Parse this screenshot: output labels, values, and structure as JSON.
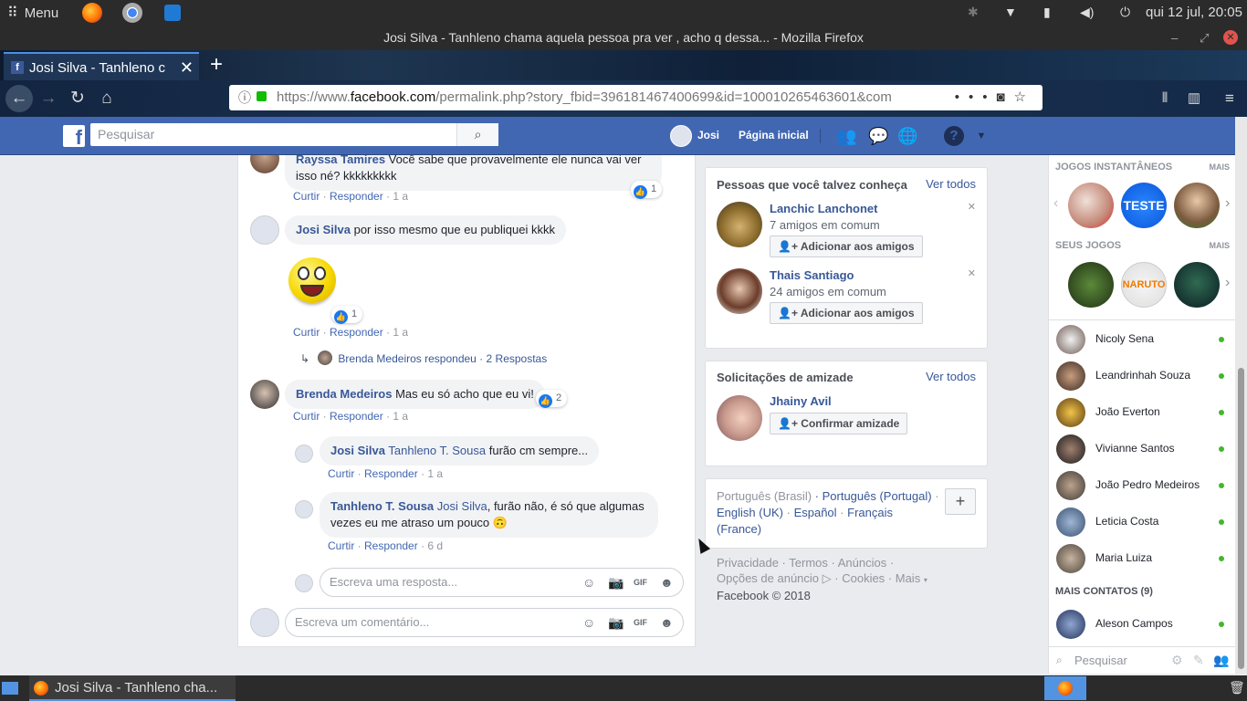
{
  "os": {
    "menu_label": "Menu",
    "clock": "qui 12 jul, 20:05"
  },
  "browser": {
    "window_title": "Josi Silva - Tanhleno chama aquela pessoa pra ver , acho q dessa... - Mozilla Firefox",
    "tab_title": "Josi Silva - Tanhleno c",
    "url_prefix": "https://www.",
    "url_domain": "facebook.com",
    "url_rest": "/permalink.php?story_fbid=396181467400699&id=100010265463601&com"
  },
  "fb": {
    "logo": "f",
    "search_placeholder": "Pesquisar",
    "user_name": "Josi",
    "home_label": "Página inicial"
  },
  "comments": {
    "c1": {
      "name": "Rayssa Tamires",
      "text": " Você sabe que provavelmente ele nunca vai ver isso né? kkkkkkkkk",
      "like": "Curtir",
      "reply": "Responder",
      "time": "1 a",
      "reactions": "1"
    },
    "c2": {
      "name": "Josi Silva",
      "text": " por isso mesmo que eu publiquei kkkk",
      "like": "Curtir",
      "reply": "Responder",
      "time": "1 a",
      "reactions": "1"
    },
    "c2_replies": {
      "name": "Brenda Medeiros respondeu",
      "count": "2 Respostas"
    },
    "c3": {
      "name": "Brenda Medeiros",
      "text": " Mas eu só acho que eu vi!",
      "like": "Curtir",
      "reply": "Responder",
      "time": "1 a",
      "reactions": "2"
    },
    "r1": {
      "name": "Josi Silva",
      "mention": "Tanhleno T. Sousa",
      "text": " furão cm sempre...",
      "like": "Curtir",
      "reply": "Responder",
      "time": "1 a"
    },
    "r2": {
      "name": "Tanhleno T. Sousa",
      "mention": "Josi Silva",
      "text": ", furão não, é só que algumas vezes eu me atraso um pouco 🙃",
      "like": "Curtir",
      "reply": "Responder",
      "time": "6 d"
    },
    "reply_placeholder": "Escreva uma resposta...",
    "comment_placeholder": "Escreva um comentário..."
  },
  "pymk": {
    "title": "Pessoas que você talvez conheça",
    "see_all": "Ver todos",
    "people": [
      {
        "name": "Lanchic Lanchonet",
        "mutual": "7 amigos em comum",
        "button": "Adicionar aos amigos"
      },
      {
        "name": "Thais Santiago",
        "mutual": "24 amigos em comum",
        "button": "Adicionar aos amigos"
      }
    ]
  },
  "requests": {
    "title": "Solicitações de amizade",
    "see_all": "Ver todos",
    "name": "Jhainy Avil",
    "button": "Confirmar amizade"
  },
  "languages": {
    "current": "Português (Brasil)",
    "options": [
      "Português (Portugal)",
      "English (UK)",
      "Español",
      "Français (France)"
    ],
    "plus": "+"
  },
  "footer": {
    "links1": [
      "Privacidade",
      "Termos",
      "Anúncios"
    ],
    "links2": [
      "Opções de anúncio",
      "Cookies",
      "Mais"
    ],
    "copyright": "Facebook © 2018"
  },
  "chat": {
    "games_title": "JOGOS INSTANTÂNEOS",
    "my_games_title": "SEUS JOGOS",
    "more": "MAIS",
    "game_teste": "TESTE",
    "contacts": [
      "Nicoly Sena",
      "Leandrinhah Souza",
      "João Everton",
      "Vivianne Santos",
      "João Pedro Medeiros",
      "Leticia Costa",
      "Maria Luiza"
    ],
    "more_contacts": "MAIS CONTATOS (9)",
    "extra_contact": "Aleson Campos",
    "search_placeholder": "Pesquisar"
  },
  "taskbar": {
    "task_label": "Josi Silva - Tanhleno cha..."
  },
  "colors": {
    "fb_blue": "#4267b2",
    "link": "#385898",
    "online": "#42b72a"
  }
}
